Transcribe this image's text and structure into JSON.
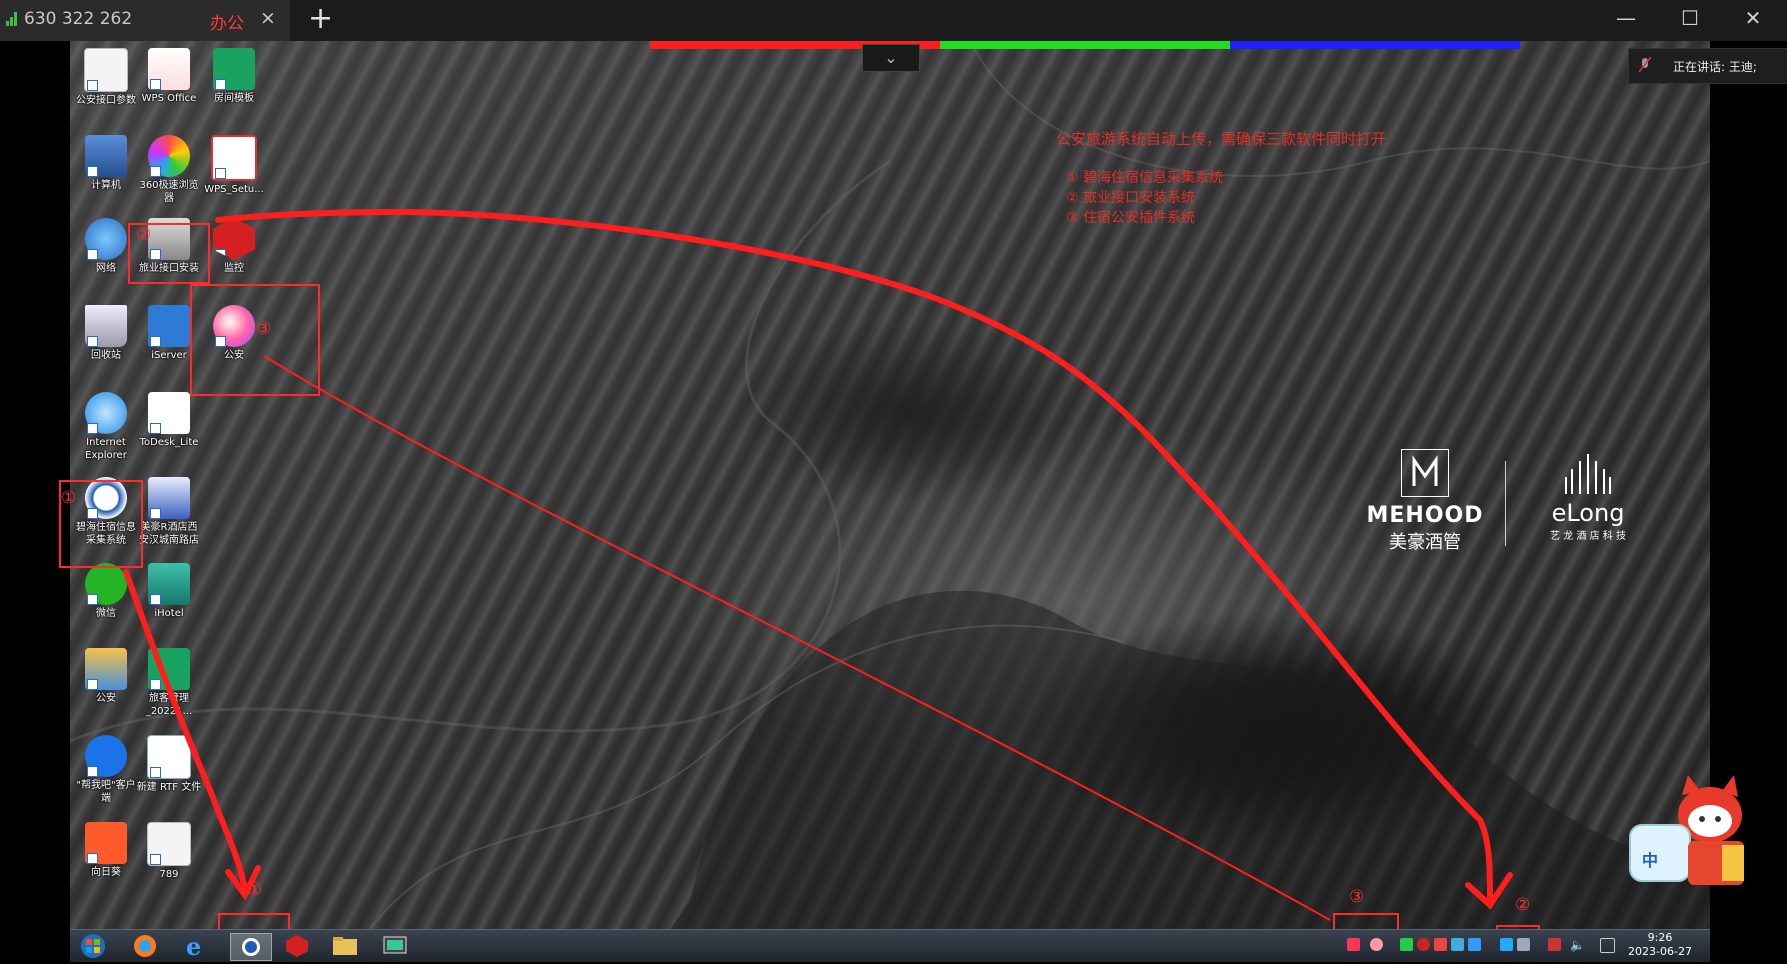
{
  "titlebar": {
    "tab_number": "630 322 262",
    "tab_name": "办公",
    "close_tab": "×",
    "new_tab": "+",
    "minimize": "—",
    "maximize": "☐",
    "close": "✕"
  },
  "colors": {
    "red_bar": "#ff2020",
    "green_bar": "#20e020",
    "blue_bar": "#2020ff",
    "annotation": "#ff2a2a"
  },
  "dropdown": {
    "icon": "chevron-down-icon",
    "label": "⌄"
  },
  "speaking": {
    "label": "正在讲话: 王迪;"
  },
  "annotation": {
    "title": "公安旅游系统自动上传，需确保三款软件同时打开",
    "items": [
      "① 碧海住宿信息采集系统",
      "② 旅业接口安装系统",
      "③ 住宿公安插件系统"
    ]
  },
  "logos": {
    "mehood_en": "MEHOOD",
    "mehood_cn": "美豪酒管",
    "elong_en": "eLong",
    "elong_cn": "艺 龙 酒 店 科 技"
  },
  "desktop_icons": [
    {
      "label": "公安接口参数",
      "icon": "document-icon"
    },
    {
      "label": "WPS Office",
      "icon": "wps-office-icon"
    },
    {
      "label": "房间模板",
      "icon": "spreadsheet-icon"
    },
    {
      "label": "计算机",
      "icon": "computer-icon"
    },
    {
      "label": "360极速浏览器",
      "icon": "360-browser-icon"
    },
    {
      "label": "WPS_Setu...",
      "icon": "wps-setup-icon"
    },
    {
      "label": "网络",
      "icon": "network-icon"
    },
    {
      "label": "旅业接口安装",
      "icon": "server-icon"
    },
    {
      "label": "监控",
      "icon": "monitor-app-icon"
    },
    {
      "label": "回收站",
      "icon": "recycle-bin-icon"
    },
    {
      "label": "iServer",
      "icon": "iserver-icon"
    },
    {
      "label": "公安",
      "icon": "police-plugin-icon"
    },
    {
      "label": "Internet Explorer",
      "icon": "ie-icon"
    },
    {
      "label": "ToDesk_Lite",
      "icon": "todesk-icon"
    },
    {
      "label": "碧海住宿信息采集系统",
      "icon": "bihai-icon"
    },
    {
      "label": "美豪R酒店西安汉城南路店",
      "icon": "hotel-doc-icon"
    },
    {
      "label": "微信",
      "icon": "wechat-icon"
    },
    {
      "label": "iHotel",
      "icon": "ihotel-icon"
    },
    {
      "label": "公安",
      "icon": "folder-zip-icon"
    },
    {
      "label": "旅客管理_20221...",
      "icon": "spreadsheet-icon"
    },
    {
      "label": "\"帮我吧\"客户端",
      "icon": "bangwoba-icon"
    },
    {
      "label": "新建 RTF 文件",
      "icon": "rtf-file-icon"
    },
    {
      "label": "向日葵",
      "icon": "sunflower-icon"
    },
    {
      "label": "789",
      "icon": "text-file-icon"
    }
  ],
  "markers": {
    "one": "①",
    "two": "②",
    "three": "③"
  },
  "taskbar": {
    "items": [
      "start-icon",
      "360-browser-icon",
      "ie-icon",
      "bihai-icon",
      "monitor-app-icon",
      "explorer-folder-icon",
      "remote-desktop-icon"
    ],
    "time": "9:26",
    "date": "2023-06-27"
  },
  "ime": {
    "label": "中"
  }
}
